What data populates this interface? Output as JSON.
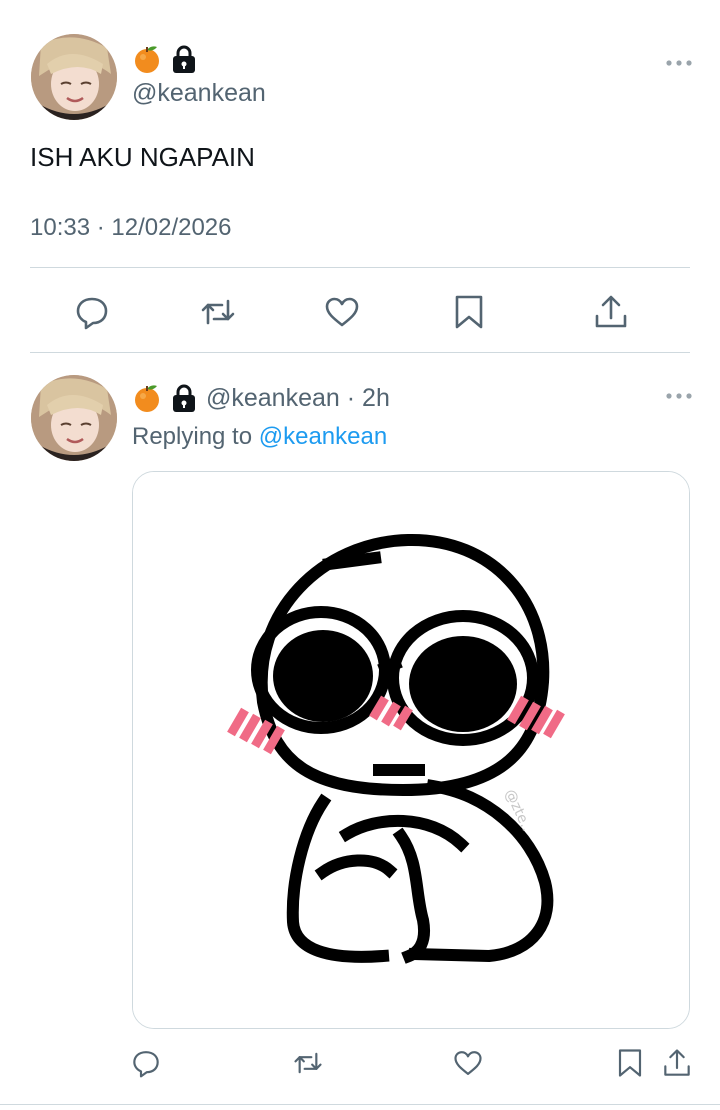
{
  "main_tweet": {
    "handle": "@keankean",
    "badge_emoji": "orange-emoji",
    "lock_icon": "lock-icon",
    "text": "ISH AKU NGAPAIN",
    "timestamp": "10:33 · 12/02/2026",
    "actions": [
      "reply-icon",
      "retweet-icon",
      "like-icon",
      "bookmark-icon",
      "share-icon"
    ]
  },
  "reply_tweet": {
    "handle": "@keankean",
    "age": "· 2h",
    "replying_prefix": "Replying to",
    "replying_handle": "@keankean",
    "media_description": "Black-and-white pixel doodle of a round character with big black eyes and pink blush",
    "media_watermark": "@zte..",
    "actions": [
      "reply-icon",
      "retweet-icon",
      "like-icon",
      "bookmark-icon",
      "share-icon"
    ]
  },
  "colors": {
    "text_primary": "#0f1419",
    "text_secondary": "#536471",
    "link": "#1d9bf0",
    "divider": "#cfd9de",
    "blush": "#f06b86"
  }
}
